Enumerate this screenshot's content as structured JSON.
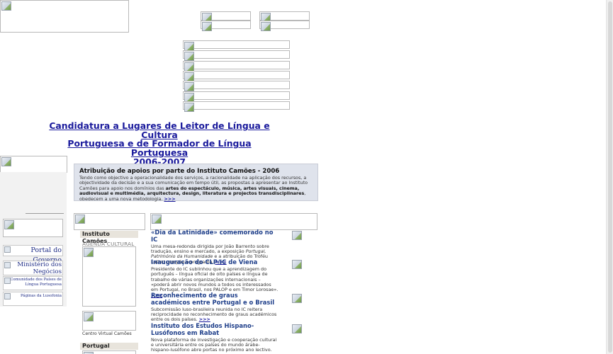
{
  "main_title": {
    "line1": "Candidatura a Lugares de Leitor de Língua e Cultura",
    "line2": "Portuguesa e de Formador de Língua Portuguesa",
    "line3": "2006-2007"
  },
  "promo": {
    "title": "Atribuição de apoios por parte do Instituto Camões - 2006",
    "body_start": "Tendo como objectivo a operacionalidade dos serviços, a racionalidade na aplicação dos recursos, a objectividade da decisão e a sua comunicação em tempo útil, as propostas a apresentar ao Instituto Camões para apoio nos domínios das ",
    "body_bold": "artes do espectáculo, música, artes visuais, cinema, audiovisual e multimédia, arquitectura, design, literatura e projectos transdisciplinares",
    "body_end": ", obedecem a uma nova metodologia. ",
    "more": ">>>"
  },
  "left_links": {
    "portal": "Portal do Governo",
    "ministerio_line1": "Ministério dos",
    "ministerio_line2": "Negócios",
    "comunidade_line1": "Comunidade dos Países de",
    "comunidade_line2": "Língua Portuguesa",
    "lusofonia": "Páginas da Lusofonia"
  },
  "sections": {
    "instituto": "Instituto Camões",
    "agenda": "AGENDA CULTURAL",
    "centro": "Centro Virtual Camões",
    "portugal": "Portugal"
  },
  "news": [
    {
      "title": "«Dia da Latinidade» comemorado no IC",
      "body_a": "Uma mesa-redonda dirigida por João Barrento sobre tradução, ensino e mercado, a exposição ",
      "body_em": "Portugal, Património da Humanidade",
      "body_b": " e a atribuição do Troféu Latino compõe o programa. ",
      "more": ">>>"
    },
    {
      "title": "Inauguração do CLP/IC de Viena",
      "body_a": "Presidente do IC sublinhou que a aprendizagem do português – língua oficial de oito países e língua de trabalho de várias organizações internacionais – «poderá abrir novos mundos a todos os interessados em Portugal, no Brasil, nos PALOP e em Timor Lorosae». ",
      "more": ">>>"
    },
    {
      "title": "Reconhecimento de graus académicos entre Portugal e o Brasil",
      "body_a": "Subcomissão luso-brasileira reunida no IC reitera reciprocidade no reconhecimento de graus académicos entre os dois países. ",
      "more": ">>>"
    },
    {
      "title": "Instituto dos Estudos Hispano-Lusófonos em Rabat",
      "body_a": "Nova plataforma de investigação e cooperação cultural e universitária entre os países do mundo árabe-hispano-lusófono abre portas no próximo ano lectivo. ",
      "more": ">>>"
    }
  ],
  "icons": {
    "broken_image": "broken-image-icon"
  }
}
